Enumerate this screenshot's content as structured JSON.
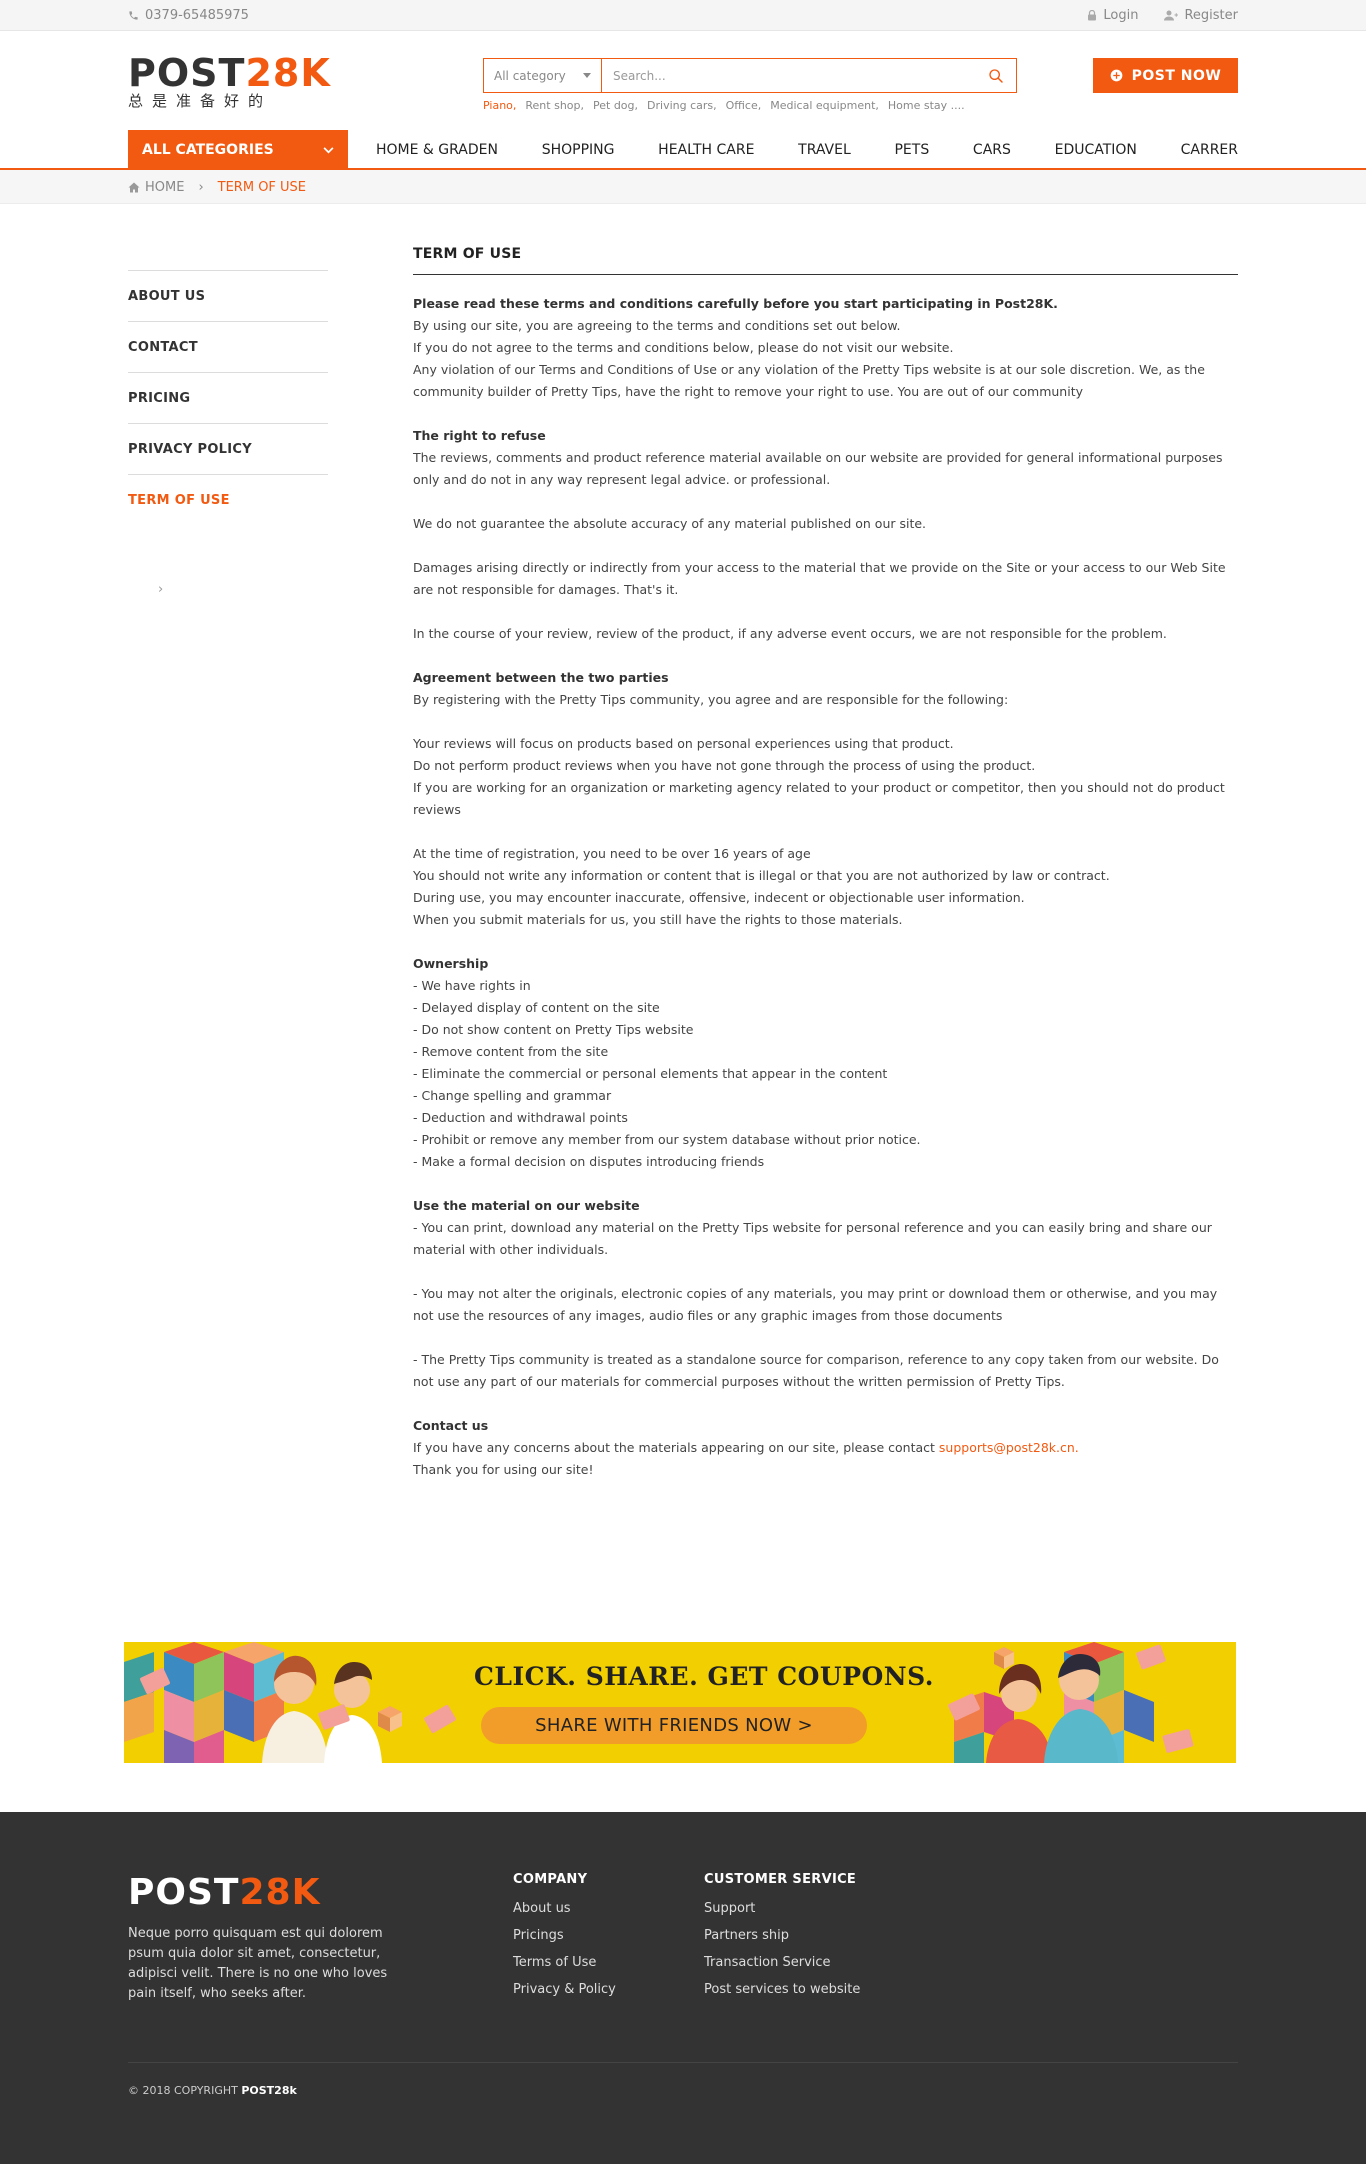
{
  "topbar": {
    "phone": "0379-65485975",
    "login": "Login",
    "register": "Register"
  },
  "logo": {
    "main": "POST",
    "accent": "28K",
    "tagline": "总是准备好的"
  },
  "search": {
    "category": "All category",
    "placeholder": "Search...",
    "tags": [
      "Piano,",
      "Rent shop,",
      "Pet dog,",
      "Driving cars,",
      "Office,",
      "Medical equipment,",
      "Home stay ...."
    ]
  },
  "post_now": "POST NOW",
  "nav": {
    "all_categories": "ALL CATEGORIES",
    "items": [
      "HOME & GRADEN",
      "SHOPPING",
      "HEALTH CARE",
      "TRAVEL",
      "PETS",
      "CARS",
      "EDUCATION",
      "CARRER"
    ]
  },
  "breadcrumb": {
    "home": "HOME",
    "separator": "›",
    "current": "TERM OF USE"
  },
  "sidebar": {
    "items": [
      "ABOUT US",
      "CONTACT",
      "PRICING",
      "PRIVACY POLICY",
      "TERM OF USE"
    ],
    "chevron": "›"
  },
  "content": {
    "title": "TERM OF USE",
    "intro_bold": "Please read these terms and conditions carefully before you start participating in Post28K.",
    "intro": [
      "By using our site, you are agreeing to the terms and conditions set out below.",
      "If you do not agree to the terms and conditions below, please do not visit our website.",
      "Any violation of our Terms and Conditions of Use or any violation of the Pretty Tips website is at our sole discretion. We, as the community builder of Pretty Tips, have the right to remove your right to use. You are out of our community"
    ],
    "refuse_title": "The right to refuse",
    "refuse": [
      "The reviews, comments and product reference material available on our website are provided for general informational purposes only and do not in any way represent legal advice. or professional.",
      "We do not guarantee the absolute accuracy of any material published on our site.",
      "Damages arising directly or indirectly from your access to the material that we provide on the Site or your access to our Web Site are not responsible for damages. That's it.",
      "In the course of your review, review of the product, if any adverse event occurs, we are not responsible for the problem."
    ],
    "agreement_title": "Agreement between the two parties",
    "agreement_intro": "By registering with the Pretty Tips community, you agree and are responsible for the following:",
    "agreement_a": [
      "Your reviews will focus on products based on personal experiences using that product.",
      "Do not perform product reviews when you have not gone through the process of using the product.",
      "If you are working for an organization or marketing agency related to your product or competitor, then you should not do product reviews"
    ],
    "agreement_b": [
      "At the time of registration, you need to be over 16 years of age",
      "You should not write any information or content that is illegal or that you are not authorized by law or contract.",
      "During use, you may encounter inaccurate, offensive, indecent or objectionable user information.",
      "When you submit materials for us, you still have the rights to those materials."
    ],
    "ownership_title": "Ownership",
    "ownership": [
      "-  We have rights in",
      "-  Delayed display of content on the site",
      "-  Do not show content on Pretty Tips website",
      "-  Remove content from the site",
      "-  Eliminate the commercial or personal elements that appear in the content",
      "-  Change spelling and grammar",
      "-  Deduction and withdrawal points",
      "-  Prohibit or remove any member from our system database without prior notice.",
      "-  Make a formal decision on disputes introducing friends"
    ],
    "use_title": "Use the material on our website",
    "use": [
      "-  You can print, download any material on the Pretty Tips website for personal reference and you can easily bring and share our material with other individuals.",
      "-  You may not alter the originals, electronic copies of any materials, you may print or download them or otherwise, and you may not use the resources of any images, audio files or any graphic images from those documents",
      "-  The Pretty Tips community is treated as a standalone source for comparison, reference to any copy taken from our website. Do not use any part of our materials for commercial purposes without the written permission of Pretty Tips."
    ],
    "contact_title": "Contact us",
    "contact_text": "If you have any concerns about the materials appearing on our site, please contact",
    "contact_email": "supports@post28k.cn.",
    "thanks": "Thank you for using our site!"
  },
  "banner": {
    "title": "CLICK. SHARE. GET COUPONS.",
    "cta": "SHARE WITH FRIENDS NOW  >",
    "bg_color": "#f2cf00"
  },
  "footer": {
    "logo_main": "POST",
    "logo_accent": "28K",
    "description": "Neque porro quisquam est qui dolorem psum quia dolor sit amet, consectetur, adipisci velit. There is no one who loves pain itself, who seeks after.",
    "company_title": "COMPANY",
    "company_links": [
      "About us",
      "Pricings",
      "Terms of Use",
      "Privacy & Policy"
    ],
    "service_title": "CUSTOMER SERVICE",
    "service_links": [
      "Support",
      "Partners ship",
      "Transaction Service",
      "Post services to website"
    ],
    "copyright": "© 2018 COPYRIGHT",
    "copyright_brand": "POST28k"
  },
  "colors": {
    "accent": "#f25a12",
    "footer_bg": "#333333"
  }
}
